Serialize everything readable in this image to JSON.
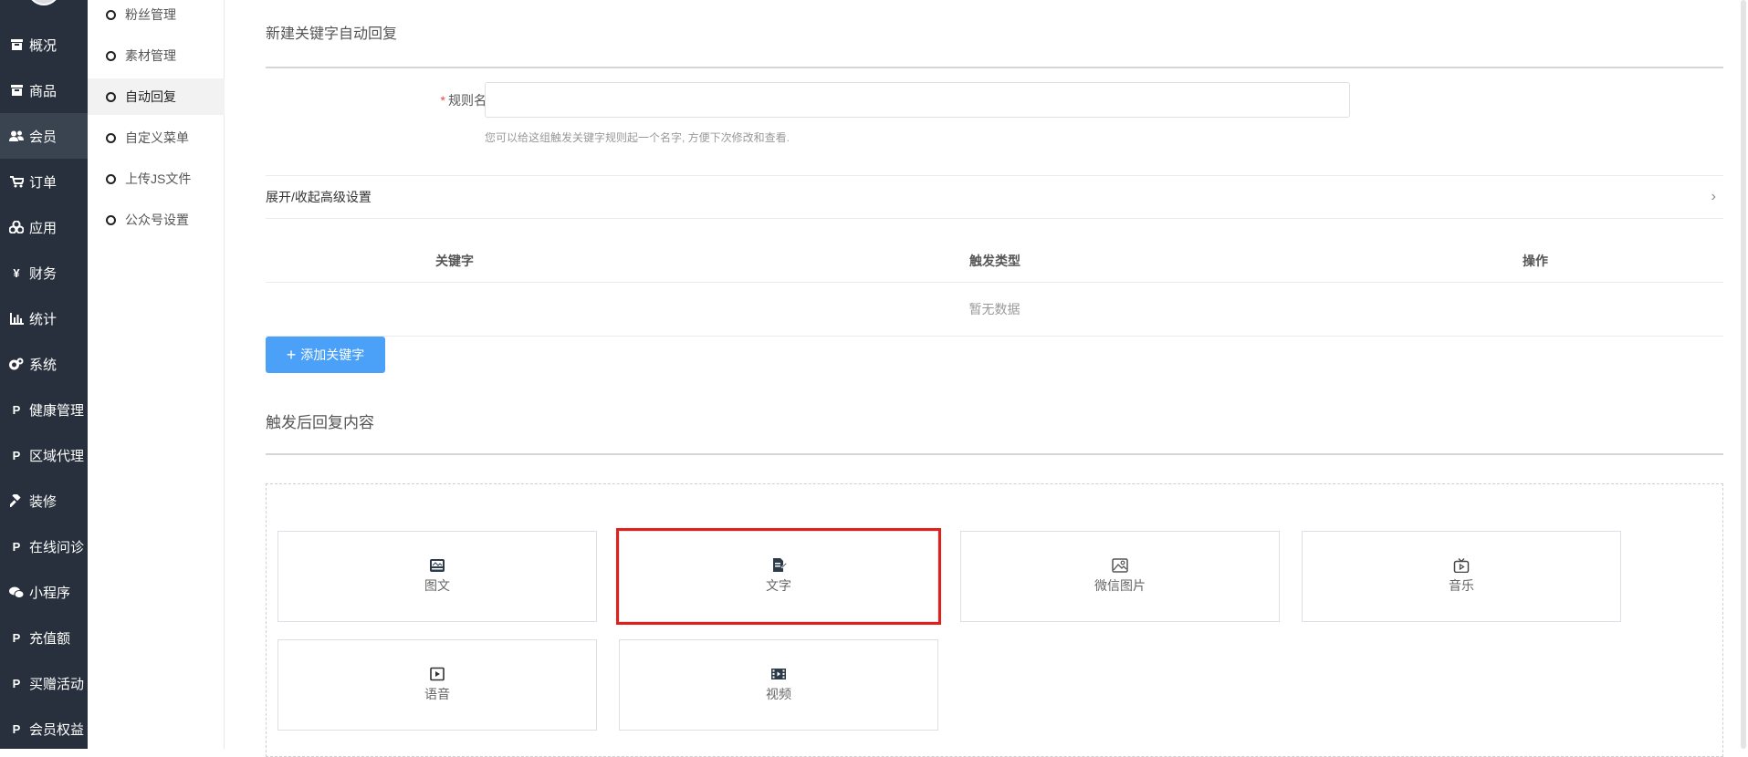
{
  "nav": {
    "items": [
      {
        "label": "概况",
        "icon": "box-icon"
      },
      {
        "label": "商品",
        "icon": "box-icon"
      },
      {
        "label": "会员",
        "icon": "users-icon"
      },
      {
        "label": "订单",
        "icon": "cart-icon"
      },
      {
        "label": "应用",
        "icon": "cubes-icon"
      },
      {
        "label": "财务",
        "icon": "yen-icon"
      },
      {
        "label": "统计",
        "icon": "bar-chart-icon"
      },
      {
        "label": "系统",
        "icon": "gears-icon"
      },
      {
        "label": "健康管理",
        "icon": "paypal-icon"
      },
      {
        "label": "区域代理",
        "icon": "paypal-icon"
      },
      {
        "label": "装修",
        "icon": "hammer-icon"
      },
      {
        "label": "在线问诊",
        "icon": "paypal-icon"
      },
      {
        "label": "小程序",
        "icon": "wechat-icon"
      },
      {
        "label": "充值额",
        "icon": "paypal-icon"
      },
      {
        "label": "买赠活动",
        "icon": "paypal-icon"
      },
      {
        "label": "会员权益",
        "icon": "paypal-icon"
      }
    ],
    "active": "会员"
  },
  "submenu": {
    "items": [
      "粉丝管理",
      "素材管理",
      "自动回复",
      "自定义菜单",
      "上传JS文件",
      "公众号设置"
    ],
    "active": "自动回复"
  },
  "page": {
    "title": "新建关键字自动回复",
    "rule_name_label": "规则名称",
    "rule_name_required": "*",
    "rule_name_value": "",
    "rule_name_hint": "您可以给这组触发关键字规则起一个名字, 方便下次修改和查看.",
    "advanced_toggle": "展开/收起高级设置",
    "table": {
      "columns": [
        "关键字",
        "触发类型",
        "操作"
      ],
      "empty_text": "暂无数据"
    },
    "add_keyword_button": "添加关键字",
    "reply_section_title": "触发后回复内容",
    "reply_types": [
      {
        "label": "图文",
        "icon": "image-text-icon"
      },
      {
        "label": "文字",
        "icon": "document-edit-icon",
        "selected": true
      },
      {
        "label": "微信图片",
        "icon": "picture-icon"
      },
      {
        "label": "音乐",
        "icon": "music-tv-icon"
      },
      {
        "label": "语音",
        "icon": "play-icon"
      },
      {
        "label": "视频",
        "icon": "film-icon"
      }
    ]
  },
  "colors": {
    "nav_bg": "#27303c",
    "primary": "#4ba1f7",
    "selected_outline": "#e0201c"
  }
}
